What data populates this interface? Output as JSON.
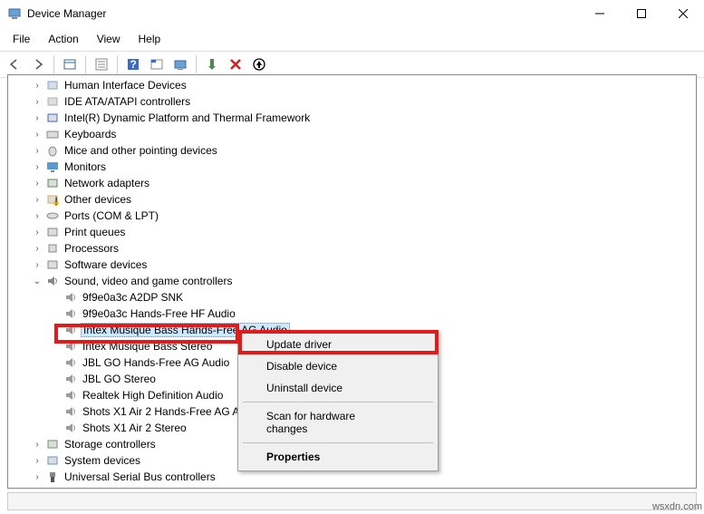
{
  "window": {
    "title": "Device Manager"
  },
  "menu": {
    "file": "File",
    "action": "Action",
    "view": "View",
    "help": "Help"
  },
  "tree": [
    {
      "indent": 1,
      "exp": "›",
      "icon": "hid",
      "label": "Human Interface Devices"
    },
    {
      "indent": 1,
      "exp": "›",
      "icon": "ide",
      "label": "IDE ATA/ATAPI controllers"
    },
    {
      "indent": 1,
      "exp": "›",
      "icon": "intel",
      "label": "Intel(R) Dynamic Platform and Thermal Framework"
    },
    {
      "indent": 1,
      "exp": "›",
      "icon": "keyboard",
      "label": "Keyboards"
    },
    {
      "indent": 1,
      "exp": "›",
      "icon": "mouse",
      "label": "Mice and other pointing devices"
    },
    {
      "indent": 1,
      "exp": "›",
      "icon": "monitor",
      "label": "Monitors"
    },
    {
      "indent": 1,
      "exp": "›",
      "icon": "network",
      "label": "Network adapters"
    },
    {
      "indent": 1,
      "exp": "›",
      "icon": "other",
      "label": "Other devices"
    },
    {
      "indent": 1,
      "exp": "›",
      "icon": "port",
      "label": "Ports (COM & LPT)"
    },
    {
      "indent": 1,
      "exp": "›",
      "icon": "printer",
      "label": "Print queues"
    },
    {
      "indent": 1,
      "exp": "›",
      "icon": "cpu",
      "label": "Processors"
    },
    {
      "indent": 1,
      "exp": "›",
      "icon": "software",
      "label": "Software devices"
    },
    {
      "indent": 1,
      "exp": "⌄",
      "icon": "sound",
      "label": "Sound, video and game controllers"
    },
    {
      "indent": 2,
      "exp": "",
      "icon": "speaker",
      "label": "9f9e0a3c A2DP SNK"
    },
    {
      "indent": 2,
      "exp": "",
      "icon": "speaker",
      "label": "9f9e0a3c Hands-Free HF Audio"
    },
    {
      "indent": 2,
      "exp": "",
      "icon": "speaker",
      "label": "Intex Musique Bass Hands-Free AG Audio",
      "selected": true
    },
    {
      "indent": 2,
      "exp": "",
      "icon": "speaker",
      "label": "Intex Musique Bass Stereo"
    },
    {
      "indent": 2,
      "exp": "",
      "icon": "speaker",
      "label": "JBL GO Hands-Free AG Audio"
    },
    {
      "indent": 2,
      "exp": "",
      "icon": "speaker",
      "label": "JBL GO Stereo"
    },
    {
      "indent": 2,
      "exp": "",
      "icon": "speaker",
      "label": "Realtek High Definition Audio"
    },
    {
      "indent": 2,
      "exp": "",
      "icon": "speaker",
      "label": "Shots X1 Air 2 Hands-Free AG Audio"
    },
    {
      "indent": 2,
      "exp": "",
      "icon": "speaker",
      "label": "Shots X1 Air 2 Stereo"
    },
    {
      "indent": 1,
      "exp": "›",
      "icon": "storage",
      "label": "Storage controllers"
    },
    {
      "indent": 1,
      "exp": "›",
      "icon": "system",
      "label": "System devices"
    },
    {
      "indent": 1,
      "exp": "›",
      "icon": "usb",
      "label": "Universal Serial Bus controllers"
    }
  ],
  "context": {
    "update": "Update driver",
    "disable": "Disable device",
    "uninstall": "Uninstall device",
    "scan": "Scan for hardware changes",
    "properties": "Properties"
  },
  "attribution": "wsxdn.com"
}
